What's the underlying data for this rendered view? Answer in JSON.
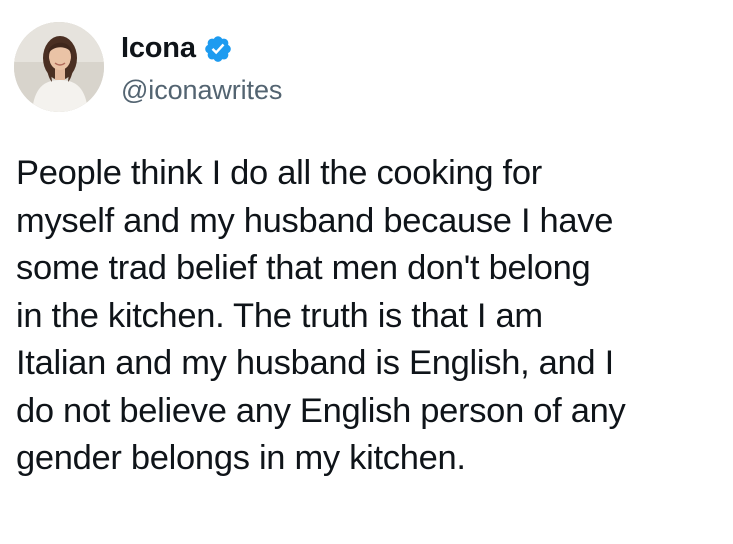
{
  "author": {
    "display_name": "Icona",
    "handle": "@iconawrites",
    "verified": true,
    "avatar_icon": "profile-photo-woman",
    "verified_icon": "verified-badge-icon"
  },
  "tweet": {
    "text": "People think I do all the cooking for\nmyself and my husband because I have\nsome trad belief that men don't belong\nin the kitchen. The truth is that I am\nItalian and my husband is English, and I\ndo not believe any English person of any\ngender belongs in my kitchen."
  },
  "colors": {
    "text_primary": "#0f1419",
    "text_secondary": "#536471",
    "verified_blue": "#1d9bf0",
    "background": "#ffffff"
  }
}
